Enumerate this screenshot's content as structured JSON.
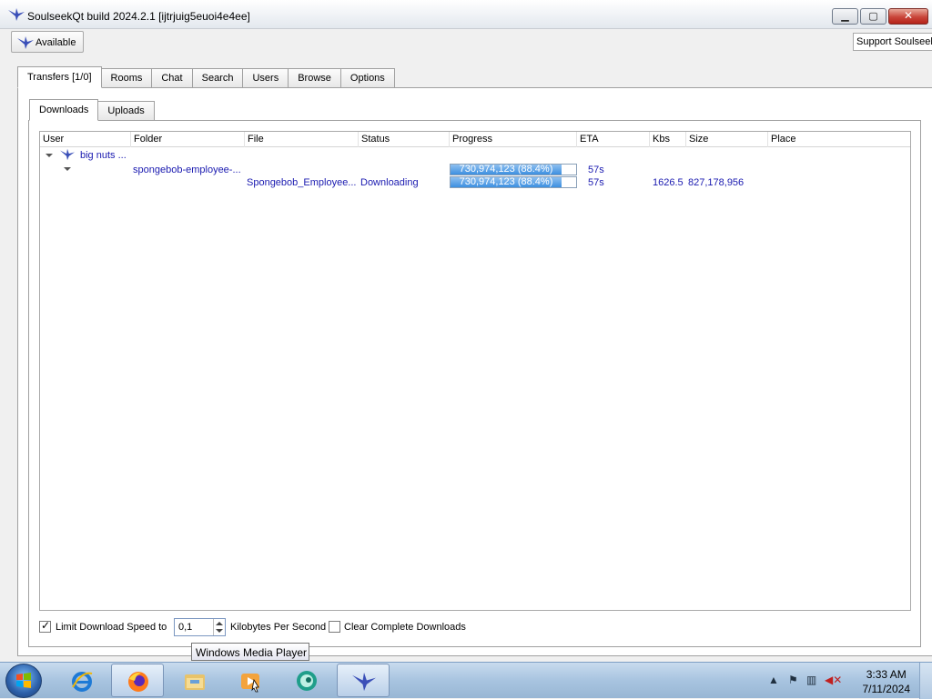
{
  "window": {
    "title": "SoulseekQt build 2024.2.1 [ijtrjuig5euoi4e4ee]",
    "controls": [
      "minimize",
      "maximize",
      "close"
    ]
  },
  "toolbar": {
    "status_label": "Available",
    "support_text": "Support Soulseek"
  },
  "main_tabs": [
    {
      "label": "Transfers [1/0]",
      "active": true
    },
    {
      "label": "Rooms",
      "active": false
    },
    {
      "label": "Chat",
      "active": false
    },
    {
      "label": "Search",
      "active": false
    },
    {
      "label": "Users",
      "active": false
    },
    {
      "label": "Browse",
      "active": false
    },
    {
      "label": "Options",
      "active": false
    }
  ],
  "sub_tabs": [
    {
      "label": "Downloads",
      "active": true
    },
    {
      "label": "Uploads",
      "active": false
    }
  ],
  "table": {
    "columns": [
      "User",
      "Folder",
      "File",
      "Status",
      "Progress",
      "ETA",
      "Kbs",
      "Size",
      "Place"
    ],
    "user_row": {
      "user": "big nuts ..."
    },
    "folder_row": {
      "folder": "spongebob-employee-...",
      "progress_text": "730,974,123 (88.4%)",
      "progress": 0.884,
      "eta": "57s"
    },
    "file_row": {
      "file": "Spongebob_Employee...",
      "status": "Downloading",
      "progress_text": "730,974,123 (88.4%)",
      "progress": 0.884,
      "eta": "57s",
      "kbs": "1626.5",
      "size": "827,178,956",
      "place": ""
    }
  },
  "footer": {
    "limit_label": "Limit Download Speed to",
    "limit_checked": true,
    "speed_value": "0,1",
    "unit_label": "Kilobytes Per Second",
    "clear_label": "Clear Complete Downloads",
    "clear_checked": false
  },
  "tooltip": "Windows Media Player",
  "taskbar": {
    "items": [
      "internet-explorer",
      "firefox",
      "file-explorer",
      "windows-media-player",
      "messenger",
      "soulseek"
    ],
    "clock_time": "3:33 AM",
    "clock_date": "7/11/2024"
  },
  "colors": {
    "accent_blue": "#1a1ab0",
    "progress_fill": "#3c8fe0",
    "close_red": "#c9453a"
  }
}
